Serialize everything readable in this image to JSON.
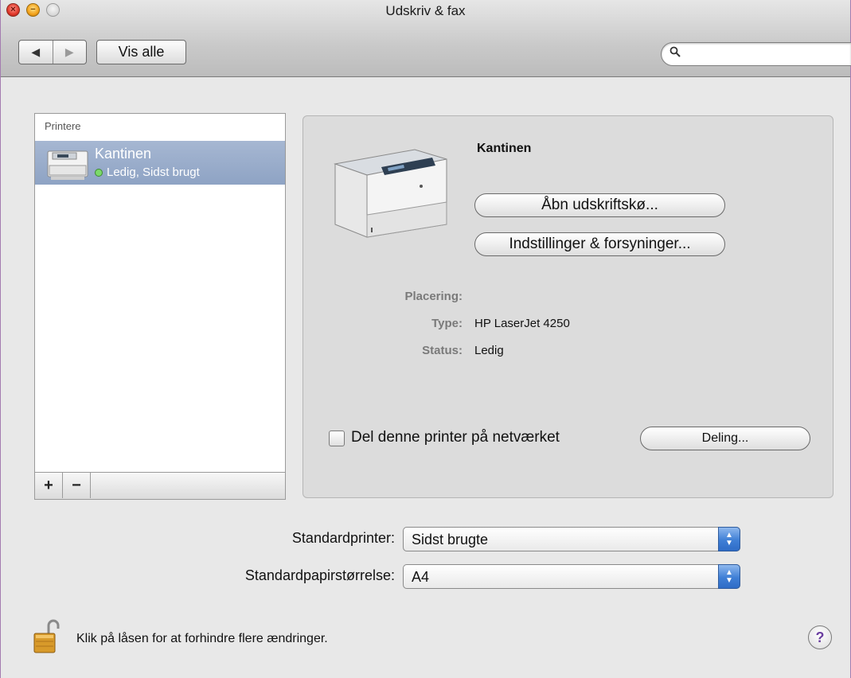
{
  "window": {
    "title": "Udskriv & fax"
  },
  "toolbar": {
    "back_glyph": "◀",
    "forward_glyph": "▶",
    "show_all_label": "Vis alle",
    "search_icon": "search-icon",
    "search_value": "",
    "search_placeholder": ""
  },
  "printers": {
    "header": "Printere",
    "items": [
      {
        "name": "Kantinen",
        "status": "Ledig, Sidst brugt",
        "status_color": "#7cd96a",
        "selected": true
      }
    ],
    "add_label": "+",
    "remove_label": "−"
  },
  "detail": {
    "name": "Kantinen",
    "open_queue_label": "Åbn udskriftskø...",
    "options_label": "Indstillinger & forsyninger...",
    "location_label": "Placering:",
    "location_value": "",
    "type_label": "Type:",
    "type_value": "HP LaserJet 4250",
    "status_label": "Status:",
    "status_value": "Ledig",
    "share_label": "Del denne printer på netværket",
    "share_checked": false,
    "sharing_button_label": "Deling..."
  },
  "defaults": {
    "printer_label": "Standardprinter:",
    "printer_value": "Sidst brugte",
    "paper_label": "Standardpapirstørrelse:",
    "paper_value": "A4"
  },
  "footer": {
    "lock_text": "Klik på låsen for at forhindre flere ændringer.",
    "help_label": "?"
  },
  "colors": {
    "selection": "#95a9c8",
    "accent": "#3f7fd6"
  }
}
